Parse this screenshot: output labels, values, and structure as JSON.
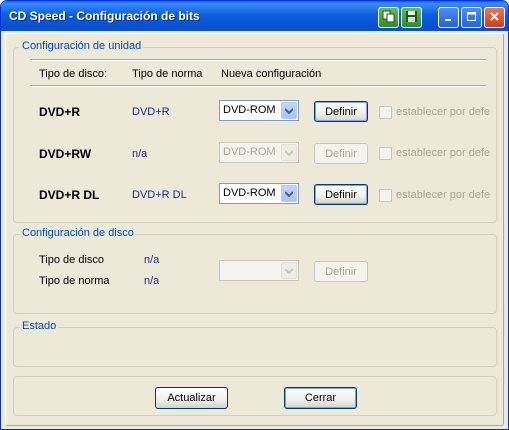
{
  "window": {
    "title": "CD Speed - Configuración de bits",
    "accent": "#0A5FE8",
    "group_title_color": "#0046D5",
    "value_color": "#1E2B8C",
    "disabled_color": "#ACA899"
  },
  "unit_config": {
    "title": "Configuración de unidad",
    "headers": {
      "disc_type": "Tipo de disco:",
      "norm_type": "Tipo de norma",
      "new_config": "Nueva configuración"
    },
    "rows": [
      {
        "disc": "DVD+R",
        "norm": "DVD+R",
        "select": "DVD-ROM",
        "button": "Definir",
        "checkbox": "establecer por defe",
        "enabled": true
      },
      {
        "disc": "DVD+RW",
        "norm": "n/a",
        "select": "DVD-ROM",
        "button": "Definir",
        "checkbox": "establecer por defe",
        "enabled": false
      },
      {
        "disc": "DVD+R DL",
        "norm": "DVD+R DL",
        "select": "DVD-ROM",
        "button": "Definir",
        "checkbox": "establecer por defe",
        "enabled": true
      }
    ]
  },
  "disc_config": {
    "title": "Configuración de disco",
    "disc_type_label": "Tipo de disco",
    "disc_type_value": "n/a",
    "norm_type_label": "Tipo de norma",
    "norm_type_value": "n/a",
    "select_value": "",
    "button": "Definir"
  },
  "status": {
    "title": "Estado",
    "text": ""
  },
  "footer": {
    "refresh": "Actualizar",
    "close": "Cerrar"
  }
}
